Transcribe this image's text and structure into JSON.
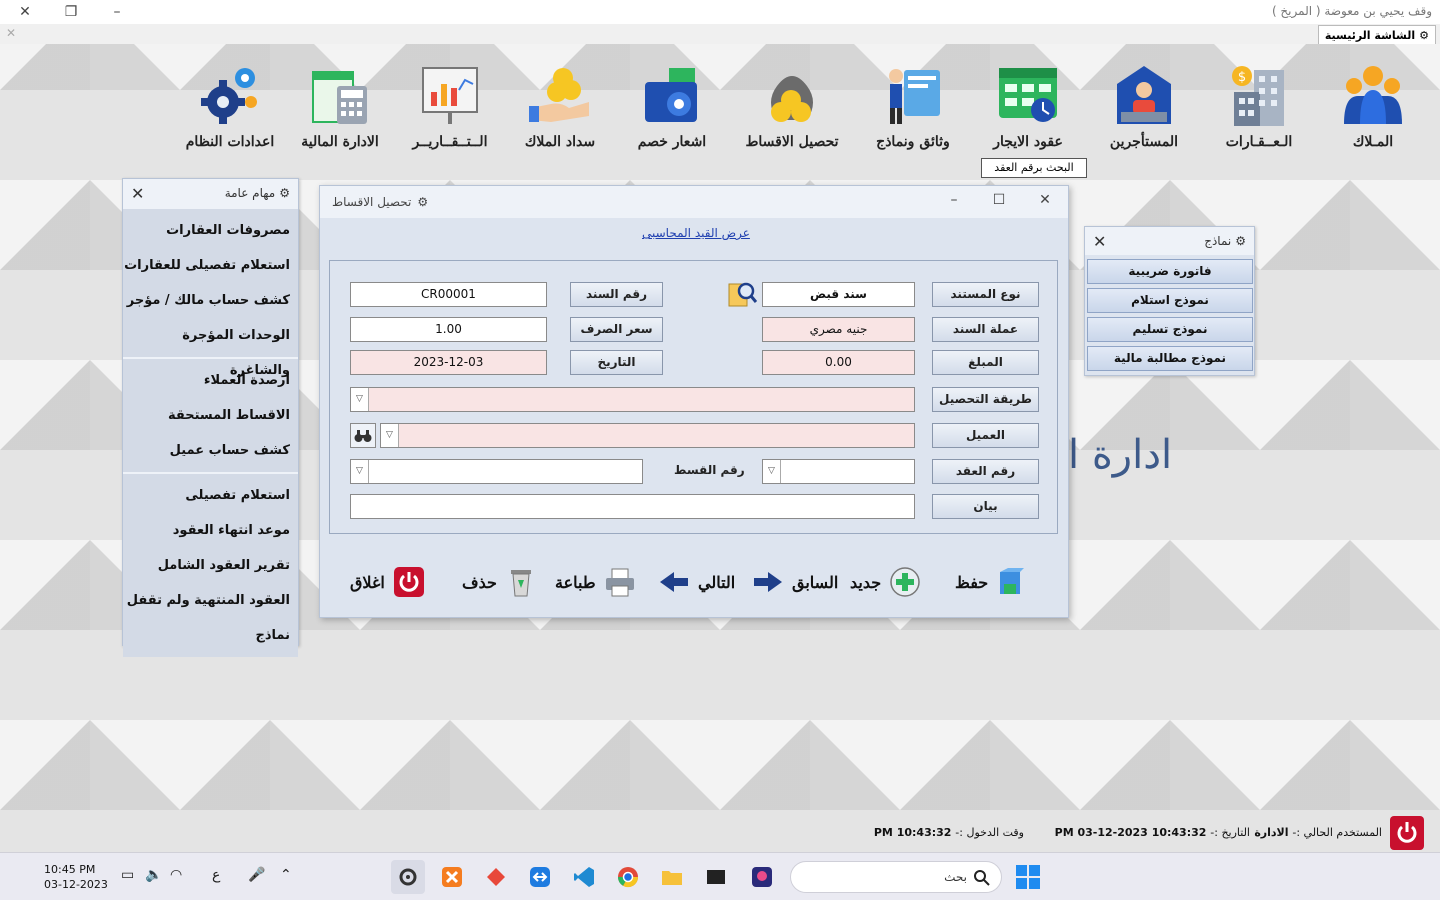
{
  "window": {
    "title": "وقف يحيي بن معوضة ( المريخ )",
    "home_tab": "الشاشة الرئيسية"
  },
  "main_menu": [
    {
      "label": "المـلاك",
      "icon": "owners-icon"
    },
    {
      "label": "الـعــقـارات",
      "icon": "properties-icon"
    },
    {
      "label": "المستأجرين",
      "icon": "tenants-icon"
    },
    {
      "label": "عقود الايجار",
      "icon": "lease-contracts-icon"
    },
    {
      "label": "وثائق ونماذج",
      "icon": "documents-icon"
    },
    {
      "label": "تحصيل الاقساط",
      "icon": "collect-installments-icon"
    },
    {
      "label": "اشعار خصم",
      "icon": "debit-note-icon"
    },
    {
      "label": "سداد الملاك",
      "icon": "owner-payment-icon"
    },
    {
      "label": "الــتــقــاريــر",
      "icon": "reports-icon"
    },
    {
      "label": "الادارة المالية",
      "icon": "financial-management-icon"
    },
    {
      "label": "اعدادات النظام",
      "icon": "system-settings-icon"
    }
  ],
  "search_hint": "البحث برقم العقد",
  "tasks_panel": {
    "title": "مهام عامة",
    "groups": [
      [
        "مصروفات العقارات",
        "استعلام تفصيلى للعقارات",
        "كشف حساب مالك / مؤجر",
        "الوحدات المؤجرة والشاغرة"
      ],
      [
        "ارصدة العملاء",
        "الاقساط  المستحقة",
        "كشف حساب عميل"
      ],
      [
        "استعلام تفصيلى",
        "موعد انتهاء العقود",
        "تقرير العقود الشامل",
        "العقود المنتهية ولم تقفل",
        "نماذج"
      ]
    ]
  },
  "forms_panel": {
    "title": "نماذج",
    "buttons": [
      "فاتورة ضريبية",
      "نموذج استلام",
      "نموذج تسليم",
      "نموذج مطالبة مالية"
    ]
  },
  "background_text": "ادارة ا",
  "dialog": {
    "title": "تحصيل الاقساط",
    "link": "عرض القيد المحاسبى",
    "labels": {
      "doc_type": "نوع المستند",
      "voucher_currency": "عملة السند",
      "amount": "المبلغ",
      "collection_method": "طريقة التحصيل",
      "customer": "العميل",
      "contract_no": "رقم العقد",
      "statement": "بيان",
      "voucher_no": "رقم السند",
      "exchange_rate": "سعر الصرف",
      "date": "التاريخ",
      "installment_no": "رقم القسط"
    },
    "values": {
      "doc_type": "سند قبض",
      "voucher_currency": "جنيه مصري",
      "amount": "0.00",
      "voucher_no": "CR00001",
      "exchange_rate": "1.00",
      "date": "2023-12-03"
    },
    "actions": {
      "save": "حفظ",
      "new": "جديد",
      "previous": "السابق",
      "next": "التالي",
      "print": "طباعة",
      "delete": "حذف",
      "close": "اغلاق"
    }
  },
  "status_bar": {
    "user_label": "المستخدم الحالي :-",
    "user_value": "الادارة",
    "date_label": "التاريخ :-",
    "date_value": "10:43:32 PM 03-12-2023",
    "login_label": "وقت الدخول :-",
    "login_value": "10:43:32 PM"
  },
  "taskbar": {
    "time": "10:45 PM",
    "date": "03-12-2023",
    "lang": "ع",
    "search_label": "بحث"
  },
  "colors": {
    "accent_blue": "#1f3fb0",
    "pink_field": "#f9e4e4",
    "panel_bg": "#dde4ef",
    "brand_red": "#c8102e"
  }
}
